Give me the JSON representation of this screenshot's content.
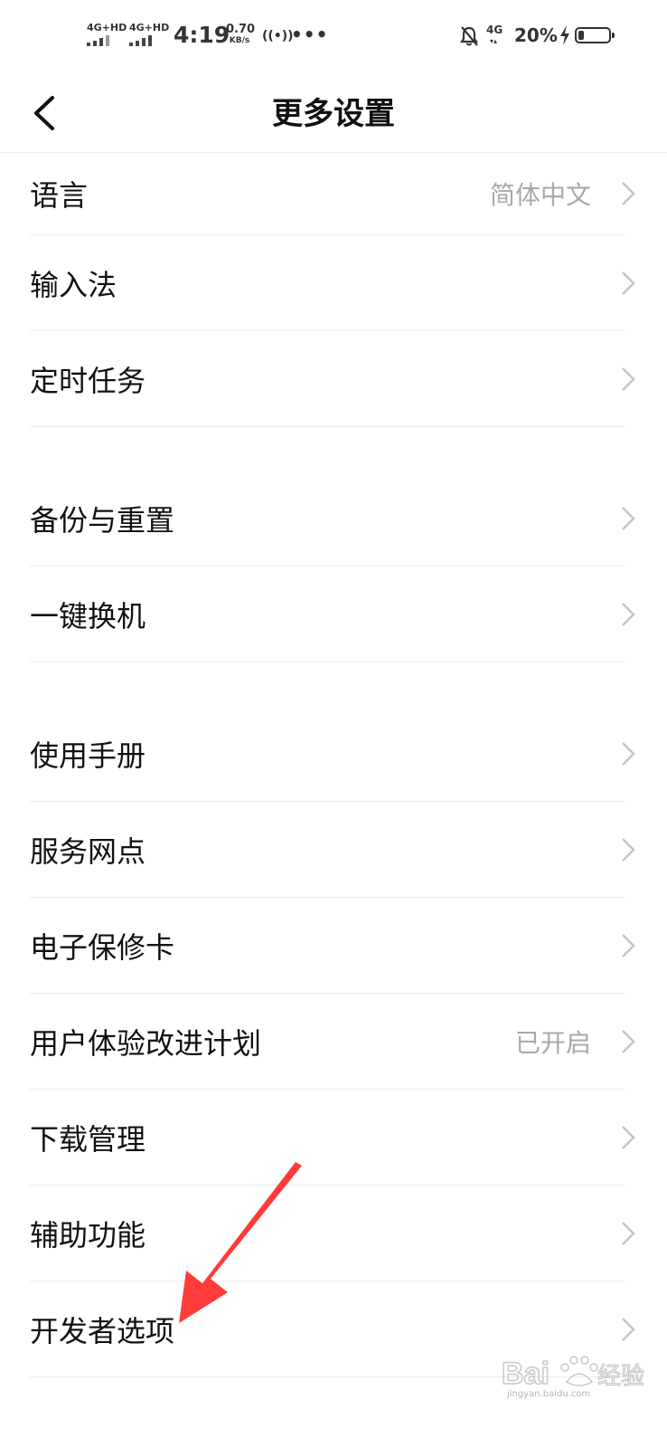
{
  "status_bar": {
    "sim1_label": "4G+HD",
    "sim2_label": "4G+HD",
    "time": "4:19",
    "speed_value": "0.70",
    "speed_unit": "KB/s",
    "hotspot_icon": "((•))",
    "more_icon": "•••",
    "data_label": "4G",
    "data_arrows": "▾▴",
    "battery_percent": "20%",
    "battery_level": 0.2
  },
  "header": {
    "back_icon": "chevron-left-icon",
    "title": "更多设置"
  },
  "settings": {
    "items": [
      {
        "label": "语言",
        "value": "简体中文"
      },
      {
        "label": "输入法",
        "value": ""
      },
      {
        "label": "定时任务",
        "value": ""
      },
      {
        "label": "备份与重置",
        "value": ""
      },
      {
        "label": "一键换机",
        "value": ""
      },
      {
        "label": "使用手册",
        "value": ""
      },
      {
        "label": "服务网点",
        "value": ""
      },
      {
        "label": "电子保修卡",
        "value": ""
      },
      {
        "label": "用户体验改进计划",
        "value": "已开启"
      },
      {
        "label": "下载管理",
        "value": ""
      },
      {
        "label": "辅助功能",
        "value": ""
      },
      {
        "label": "开发者选项",
        "value": ""
      }
    ]
  },
  "colors": {
    "text": "#111111",
    "secondary": "#a9a9a9",
    "chevron": "#c4c4c4",
    "annotation_arrow": "#ff3b3b"
  },
  "watermark": {
    "brand": "Baidu经验",
    "url": "jingyan.baidu.com"
  }
}
